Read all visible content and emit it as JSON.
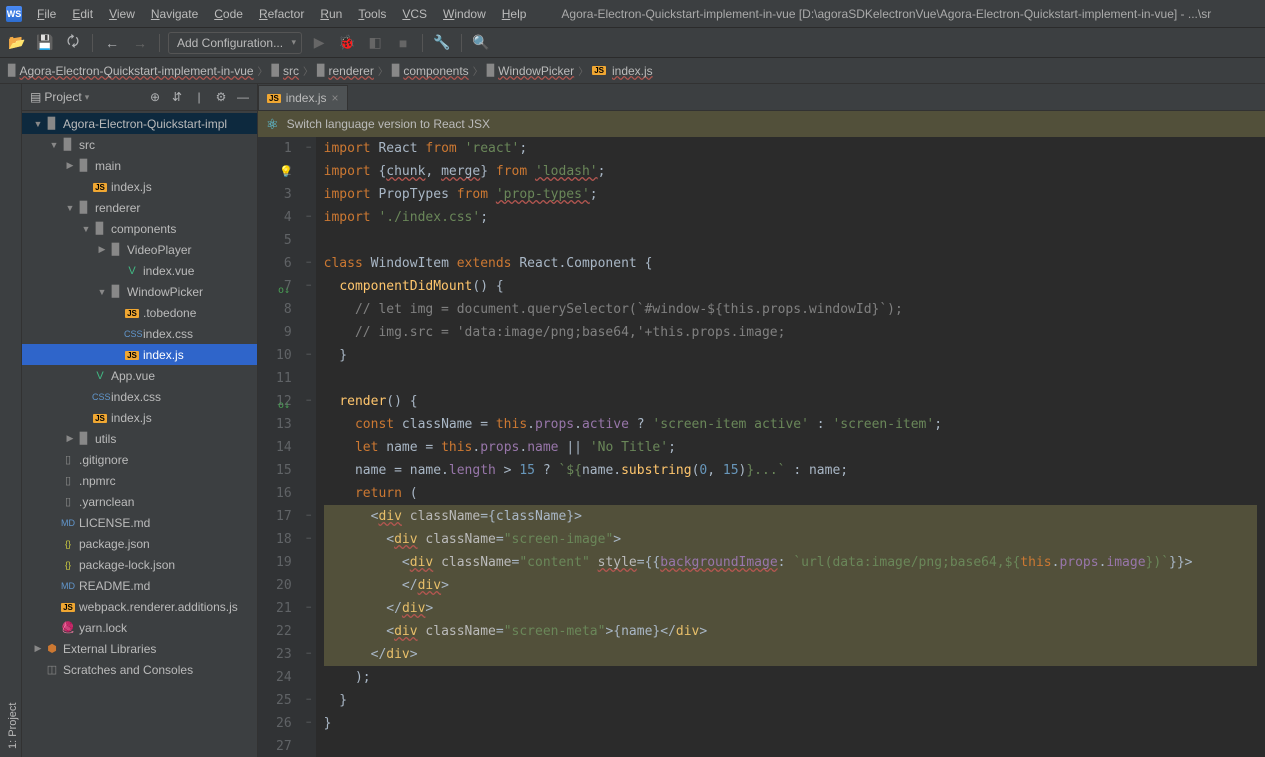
{
  "title_path": "Agora-Electron-Quickstart-implement-in-vue [D:\\agoraSDKelectronVue\\Agora-Electron-Quickstart-implement-in-vue] - ...\\sr",
  "menus": [
    "File",
    "Edit",
    "View",
    "Navigate",
    "Code",
    "Refactor",
    "Run",
    "Tools",
    "VCS",
    "Window",
    "Help"
  ],
  "config_selector": "Add Configuration...",
  "breadcrumb": [
    "Agora-Electron-Quickstart-implement-in-vue",
    "src",
    "renderer",
    "components",
    "WindowPicker",
    "index.js"
  ],
  "sidebar": {
    "title": "Project",
    "tree": [
      {
        "depth": 0,
        "chev": "▼",
        "icon": "dir",
        "name": "Agora-Electron-Quickstart-impl",
        "sel": "dim"
      },
      {
        "depth": 1,
        "chev": "▼",
        "icon": "dir",
        "name": "src"
      },
      {
        "depth": 2,
        "chev": "▶",
        "icon": "dir",
        "name": "main"
      },
      {
        "depth": 3,
        "chev": "",
        "icon": "js",
        "name": "index.js"
      },
      {
        "depth": 2,
        "chev": "▼",
        "icon": "dir",
        "name": "renderer"
      },
      {
        "depth": 3,
        "chev": "▼",
        "icon": "dir",
        "name": "components"
      },
      {
        "depth": 4,
        "chev": "▶",
        "icon": "dir",
        "name": "VideoPlayer"
      },
      {
        "depth": 5,
        "chev": "",
        "icon": "vue",
        "name": "index.vue"
      },
      {
        "depth": 4,
        "chev": "▼",
        "icon": "dir",
        "name": "WindowPicker"
      },
      {
        "depth": 5,
        "chev": "",
        "icon": "js",
        "name": ".tobedone"
      },
      {
        "depth": 5,
        "chev": "",
        "icon": "css",
        "name": "index.css"
      },
      {
        "depth": 5,
        "chev": "",
        "icon": "js",
        "name": "index.js",
        "sel": "sel"
      },
      {
        "depth": 3,
        "chev": "",
        "icon": "vue",
        "name": "App.vue"
      },
      {
        "depth": 3,
        "chev": "",
        "icon": "css",
        "name": "index.css"
      },
      {
        "depth": 3,
        "chev": "",
        "icon": "js",
        "name": "index.js"
      },
      {
        "depth": 2,
        "chev": "▶",
        "icon": "dir",
        "name": "utils"
      },
      {
        "depth": 1,
        "chev": "",
        "icon": "file",
        "name": ".gitignore"
      },
      {
        "depth": 1,
        "chev": "",
        "icon": "file",
        "name": ".npmrc"
      },
      {
        "depth": 1,
        "chev": "",
        "icon": "file",
        "name": ".yarnclean"
      },
      {
        "depth": 1,
        "chev": "",
        "icon": "md",
        "name": "LICENSE.md"
      },
      {
        "depth": 1,
        "chev": "",
        "icon": "json",
        "name": "package.json"
      },
      {
        "depth": 1,
        "chev": "",
        "icon": "json",
        "name": "package-lock.json"
      },
      {
        "depth": 1,
        "chev": "",
        "icon": "md",
        "name": "README.md"
      },
      {
        "depth": 1,
        "chev": "",
        "icon": "js",
        "name": "webpack.renderer.additions.js"
      },
      {
        "depth": 1,
        "chev": "",
        "icon": "yarn",
        "name": "yarn.lock"
      },
      {
        "depth": 0,
        "chev": "▶",
        "icon": "lib",
        "name": "External Libraries"
      },
      {
        "depth": 0,
        "chev": "",
        "icon": "scratch",
        "name": "Scratches and Consoles"
      }
    ]
  },
  "tab": {
    "name": "index.js"
  },
  "notice": "Switch language version to React JSX",
  "gutter_tab": "1: Project",
  "code_lines": [
    {
      "n": 1,
      "fold": "−",
      "html": "<span class='kw'>import</span> React <span class='kw'>from</span> <span class='str'>'react'</span>;"
    },
    {
      "n": 2,
      "fold": "",
      "bulb": true,
      "html": "<span class='kw'>import</span> {<span class='err-line'>chunk</span>, <span class='err-line'>merge</span>} <span class='kw'>from</span> <span class='str err-line'>'lodash'</span>;"
    },
    {
      "n": 3,
      "fold": "",
      "html": "<span class='kw'>import</span> PropTypes <span class='kw'>from</span> <span class='str err-line'>'prop-types'</span>;"
    },
    {
      "n": 4,
      "fold": "−",
      "html": "<span class='kw'>import</span> <span class='str'>'./index.css'</span>;"
    },
    {
      "n": 5,
      "fold": "",
      "html": ""
    },
    {
      "n": 6,
      "fold": "−",
      "html": "<span class='kw'>class</span> WindowItem <span class='kw'>extends</span> React.Component {"
    },
    {
      "n": 7,
      "fold": "−",
      "ov": true,
      "html": "  <span class='fn'>componentDidMount</span>() {"
    },
    {
      "n": 8,
      "fold": "",
      "html": "    <span class='cmt'>// let img = document.querySelector(`#window-${this.props.windowId}`);</span>"
    },
    {
      "n": 9,
      "fold": "",
      "html": "    <span class='cmt'>// img.src = 'data:image/png;base64,'+this.props.image;</span>"
    },
    {
      "n": 10,
      "fold": "−",
      "html": "  }"
    },
    {
      "n": 11,
      "fold": "",
      "html": ""
    },
    {
      "n": 12,
      "fold": "−",
      "ov": true,
      "html": "  <span class='fn'>render</span>() {"
    },
    {
      "n": 13,
      "fold": "",
      "html": "    <span class='kw'>const</span> className = <span class='kw'>this</span>.<span class='prop'>props</span>.<span class='prop'>active</span> ? <span class='str'>'screen-item active'</span> : <span class='str'>'screen-item'</span>;"
    },
    {
      "n": 14,
      "fold": "",
      "html": "    <span class='kw'>let</span> name = <span class='kw'>this</span>.<span class='prop'>props</span>.<span class='prop'>name</span> || <span class='str'>'No Title'</span>;"
    },
    {
      "n": 15,
      "fold": "",
      "html": "    name = name.<span class='prop'>length</span> &gt; <span class='num'>15</span> ? <span class='str'>`${</span>name.<span class='fn'>substring</span>(<span class='num'>0</span>, <span class='num'>15</span>)<span class='str'>}...`</span> : name;"
    },
    {
      "n": 16,
      "fold": "",
      "html": "    <span class='kw'>return</span> ("
    },
    {
      "n": 17,
      "fold": "−",
      "warn": true,
      "html": "      &lt;<span class='tag err-line'>div</span> <span class='attr'>className</span>={className}&gt;"
    },
    {
      "n": 18,
      "fold": "−",
      "warn": true,
      "html": "        &lt;<span class='tag err-line'>div</span> <span class='attr'>className</span>=<span class='str'>\"screen-image\"</span>&gt;"
    },
    {
      "n": 19,
      "fold": "",
      "warn": true,
      "html": "          &lt;<span class='tag err-line'>div</span> <span class='attr'>className</span>=<span class='str'>\"content\"</span> <span class='attr err-line'>style</span>={{<span class='prop err-line'>backgroundImage</span>: <span class='str'>`url(data:image/png;base64,${</span><span class='kw'>this</span>.<span class='prop'>props</span>.<span class='prop'>image</span><span class='str'>})`</span>}}&gt;"
    },
    {
      "n": 20,
      "fold": "",
      "warn": true,
      "html": "          &lt;/<span class='tag err-line'>div</span>&gt;"
    },
    {
      "n": 21,
      "fold": "−",
      "warn": true,
      "html": "        &lt;/<span class='tag err-line'>div</span>&gt;"
    },
    {
      "n": 22,
      "fold": "",
      "warn": true,
      "html": "        &lt;<span class='tag err-line'>div</span> <span class='attr'>className</span>=<span class='str'>\"screen-meta\"</span>&gt;{name}&lt;/<span class='tag'>div</span>&gt;"
    },
    {
      "n": 23,
      "fold": "−",
      "warn": true,
      "html": "      &lt;/<span class='tag'>div</span>&gt;"
    },
    {
      "n": 24,
      "fold": "",
      "html": "    );"
    },
    {
      "n": 25,
      "fold": "−",
      "html": "  }"
    },
    {
      "n": 26,
      "fold": "−",
      "html": "}"
    },
    {
      "n": 27,
      "fold": "",
      "html": ""
    }
  ]
}
